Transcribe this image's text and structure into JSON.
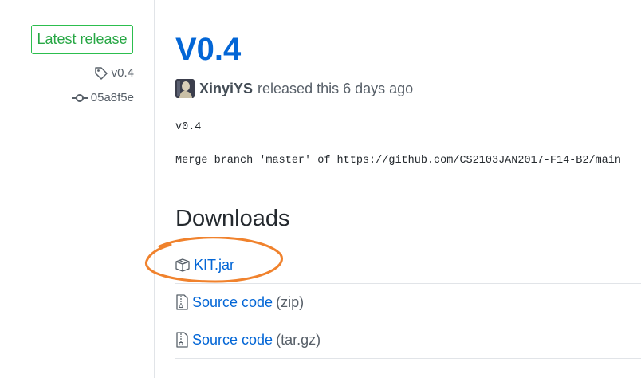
{
  "sidebar": {
    "latest_label": "Latest release",
    "tag": "v0.4",
    "commit": "05a8f5e"
  },
  "release": {
    "title": "V0.4",
    "author": "XinyiYS",
    "released_text": "released this 6 days ago",
    "notes": {
      "line1": "v0.4",
      "line2": "Merge branch 'master' of https://github.com/CS2103JAN2017-F14-B2/main"
    }
  },
  "downloads": {
    "heading": "Downloads",
    "items": [
      {
        "label": "KIT.jar",
        "ext": "",
        "icon": "package-icon"
      },
      {
        "label": "Source code",
        "ext": "(zip)",
        "icon": "file-zip-icon"
      },
      {
        "label": "Source code",
        "ext": "(tar.gz)",
        "icon": "file-zip-icon"
      }
    ]
  },
  "colors": {
    "link": "#0366d6",
    "latest_green": "#28a745",
    "highlight_orange": "#f0822d",
    "muted": "#586069"
  }
}
